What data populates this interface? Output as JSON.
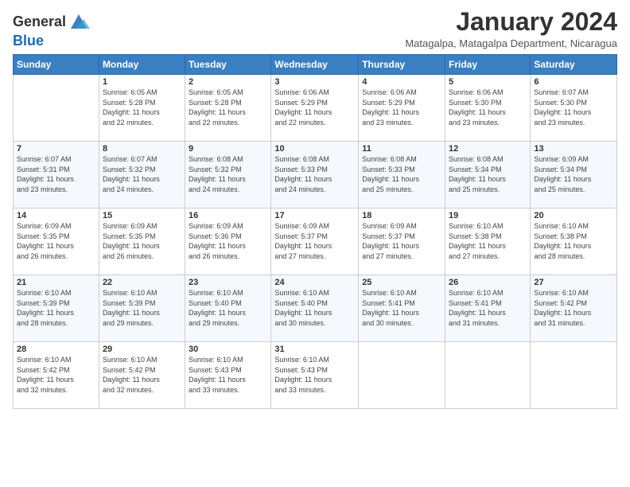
{
  "header": {
    "logo_line1": "General",
    "logo_line2": "Blue",
    "month_title": "January 2024",
    "location": "Matagalpa, Matagalpa Department, Nicaragua"
  },
  "weekdays": [
    "Sunday",
    "Monday",
    "Tuesday",
    "Wednesday",
    "Thursday",
    "Friday",
    "Saturday"
  ],
  "weeks": [
    [
      {
        "day": "",
        "info": ""
      },
      {
        "day": "1",
        "info": "Sunrise: 6:05 AM\nSunset: 5:28 PM\nDaylight: 11 hours\nand 22 minutes."
      },
      {
        "day": "2",
        "info": "Sunrise: 6:05 AM\nSunset: 5:28 PM\nDaylight: 11 hours\nand 22 minutes."
      },
      {
        "day": "3",
        "info": "Sunrise: 6:06 AM\nSunset: 5:29 PM\nDaylight: 11 hours\nand 22 minutes."
      },
      {
        "day": "4",
        "info": "Sunrise: 6:06 AM\nSunset: 5:29 PM\nDaylight: 11 hours\nand 23 minutes."
      },
      {
        "day": "5",
        "info": "Sunrise: 6:06 AM\nSunset: 5:30 PM\nDaylight: 11 hours\nand 23 minutes."
      },
      {
        "day": "6",
        "info": "Sunrise: 6:07 AM\nSunset: 5:30 PM\nDaylight: 11 hours\nand 23 minutes."
      }
    ],
    [
      {
        "day": "7",
        "info": "Sunrise: 6:07 AM\nSunset: 5:31 PM\nDaylight: 11 hours\nand 23 minutes."
      },
      {
        "day": "8",
        "info": "Sunrise: 6:07 AM\nSunset: 5:32 PM\nDaylight: 11 hours\nand 24 minutes."
      },
      {
        "day": "9",
        "info": "Sunrise: 6:08 AM\nSunset: 5:32 PM\nDaylight: 11 hours\nand 24 minutes."
      },
      {
        "day": "10",
        "info": "Sunrise: 6:08 AM\nSunset: 5:33 PM\nDaylight: 11 hours\nand 24 minutes."
      },
      {
        "day": "11",
        "info": "Sunrise: 6:08 AM\nSunset: 5:33 PM\nDaylight: 11 hours\nand 25 minutes."
      },
      {
        "day": "12",
        "info": "Sunrise: 6:08 AM\nSunset: 5:34 PM\nDaylight: 11 hours\nand 25 minutes."
      },
      {
        "day": "13",
        "info": "Sunrise: 6:09 AM\nSunset: 5:34 PM\nDaylight: 11 hours\nand 25 minutes."
      }
    ],
    [
      {
        "day": "14",
        "info": "Sunrise: 6:09 AM\nSunset: 5:35 PM\nDaylight: 11 hours\nand 26 minutes."
      },
      {
        "day": "15",
        "info": "Sunrise: 6:09 AM\nSunset: 5:35 PM\nDaylight: 11 hours\nand 26 minutes."
      },
      {
        "day": "16",
        "info": "Sunrise: 6:09 AM\nSunset: 5:36 PM\nDaylight: 11 hours\nand 26 minutes."
      },
      {
        "day": "17",
        "info": "Sunrise: 6:09 AM\nSunset: 5:37 PM\nDaylight: 11 hours\nand 27 minutes."
      },
      {
        "day": "18",
        "info": "Sunrise: 6:09 AM\nSunset: 5:37 PM\nDaylight: 11 hours\nand 27 minutes."
      },
      {
        "day": "19",
        "info": "Sunrise: 6:10 AM\nSunset: 5:38 PM\nDaylight: 11 hours\nand 27 minutes."
      },
      {
        "day": "20",
        "info": "Sunrise: 6:10 AM\nSunset: 5:38 PM\nDaylight: 11 hours\nand 28 minutes."
      }
    ],
    [
      {
        "day": "21",
        "info": "Sunrise: 6:10 AM\nSunset: 5:39 PM\nDaylight: 11 hours\nand 28 minutes."
      },
      {
        "day": "22",
        "info": "Sunrise: 6:10 AM\nSunset: 5:39 PM\nDaylight: 11 hours\nand 29 minutes."
      },
      {
        "day": "23",
        "info": "Sunrise: 6:10 AM\nSunset: 5:40 PM\nDaylight: 11 hours\nand 29 minutes."
      },
      {
        "day": "24",
        "info": "Sunrise: 6:10 AM\nSunset: 5:40 PM\nDaylight: 11 hours\nand 30 minutes."
      },
      {
        "day": "25",
        "info": "Sunrise: 6:10 AM\nSunset: 5:41 PM\nDaylight: 11 hours\nand 30 minutes."
      },
      {
        "day": "26",
        "info": "Sunrise: 6:10 AM\nSunset: 5:41 PM\nDaylight: 11 hours\nand 31 minutes."
      },
      {
        "day": "27",
        "info": "Sunrise: 6:10 AM\nSunset: 5:42 PM\nDaylight: 11 hours\nand 31 minutes."
      }
    ],
    [
      {
        "day": "28",
        "info": "Sunrise: 6:10 AM\nSunset: 5:42 PM\nDaylight: 11 hours\nand 32 minutes."
      },
      {
        "day": "29",
        "info": "Sunrise: 6:10 AM\nSunset: 5:42 PM\nDaylight: 11 hours\nand 32 minutes."
      },
      {
        "day": "30",
        "info": "Sunrise: 6:10 AM\nSunset: 5:43 PM\nDaylight: 11 hours\nand 33 minutes."
      },
      {
        "day": "31",
        "info": "Sunrise: 6:10 AM\nSunset: 5:43 PM\nDaylight: 11 hours\nand 33 minutes."
      },
      {
        "day": "",
        "info": ""
      },
      {
        "day": "",
        "info": ""
      },
      {
        "day": "",
        "info": ""
      }
    ]
  ]
}
